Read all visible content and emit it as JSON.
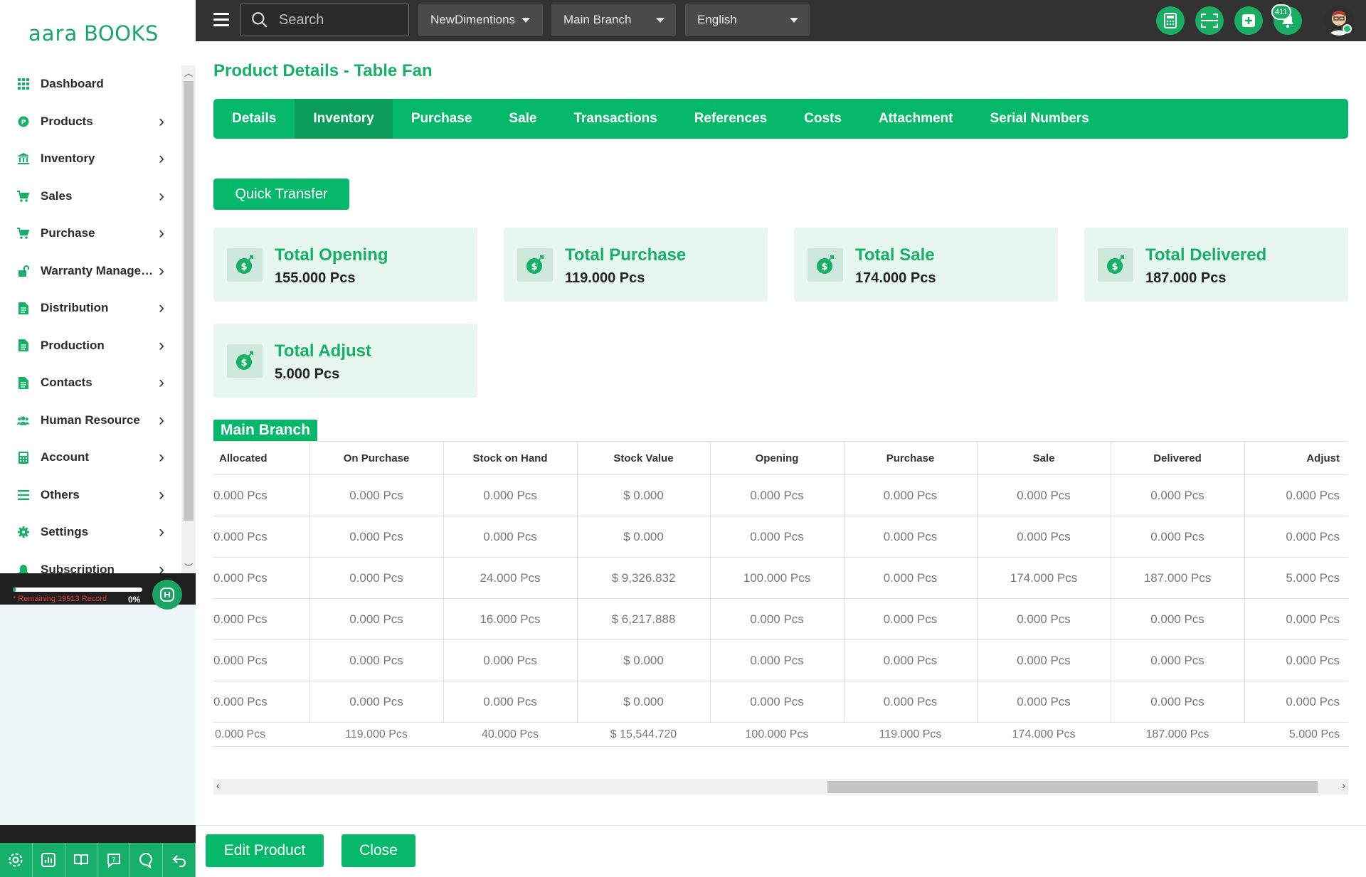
{
  "app": {
    "logo_text": "aaraBOOKS"
  },
  "sidebar": {
    "items": [
      {
        "label": "Dashboard",
        "icon": "dashboard-grid-icon",
        "has_children": false
      },
      {
        "label": "Products",
        "icon": "products-circle-icon",
        "has_children": true
      },
      {
        "label": "Inventory",
        "icon": "bank-building-icon",
        "has_children": true
      },
      {
        "label": "Sales",
        "icon": "cart-icon",
        "has_children": true
      },
      {
        "label": "Purchase",
        "icon": "cart-icon",
        "has_children": true
      },
      {
        "label": "Warranty Management",
        "icon": "unlock-icon",
        "has_children": true
      },
      {
        "label": "Distribution",
        "icon": "document-icon",
        "has_children": true
      },
      {
        "label": "Production",
        "icon": "document-icon",
        "has_children": true
      },
      {
        "label": "Contacts",
        "icon": "document-icon",
        "has_children": true
      },
      {
        "label": "Human Resource",
        "icon": "users-icon",
        "has_children": true
      },
      {
        "label": "Account",
        "icon": "calculator-icon",
        "has_children": true
      },
      {
        "label": "Others",
        "icon": "list-icon",
        "has_children": true
      },
      {
        "label": "Settings",
        "icon": "gear-icon",
        "has_children": true
      },
      {
        "label": "Subscription",
        "icon": "bell-icon",
        "has_children": true
      }
    ],
    "record_text": "* Remaining 19913 Record",
    "record_percent": "0%",
    "record_progress": 0.02,
    "bottom_icons": [
      "gear-icon",
      "chart-icon",
      "book-icon",
      "help-icon",
      "chat-icon",
      "undo-icon"
    ]
  },
  "topbar": {
    "search_placeholder": "Search",
    "company": "NewDimentions",
    "branch": "Main Branch",
    "language": "English",
    "notification_count": "411",
    "icons": [
      "calculator-icon",
      "scan-icon",
      "add-icon",
      "bell-icon"
    ]
  },
  "page": {
    "title": "Product Details - Table Fan",
    "tabs": [
      "Details",
      "Inventory",
      "Purchase",
      "Sale",
      "Transactions",
      "References",
      "Costs",
      "Attachment",
      "Serial Numbers"
    ],
    "active_tab": "Inventory",
    "quick_transfer_label": "Quick Transfer",
    "cards": [
      {
        "title": "Total Opening",
        "value": "155.000 Pcs"
      },
      {
        "title": "Total Purchase",
        "value": "119.000 Pcs"
      },
      {
        "title": "Total Sale",
        "value": "174.000 Pcs"
      },
      {
        "title": "Total Delivered",
        "value": "187.000 Pcs"
      },
      {
        "title": "Total Adjust",
        "value": "5.000 Pcs"
      }
    ],
    "branch_label": "Main Branch",
    "table": {
      "columns": [
        "Allocated",
        "On Purchase",
        "Stock on Hand",
        "Stock Value",
        "Opening",
        "Purchase",
        "Sale",
        "Delivered",
        "Adjust"
      ],
      "rows": [
        [
          "0.000 Pcs",
          "0.000 Pcs",
          "0.000 Pcs",
          "$ 0.000",
          "0.000 Pcs",
          "0.000 Pcs",
          "0.000 Pcs",
          "0.000 Pcs",
          "0.000 Pcs"
        ],
        [
          "0.000 Pcs",
          "0.000 Pcs",
          "0.000 Pcs",
          "$ 0.000",
          "0.000 Pcs",
          "0.000 Pcs",
          "0.000 Pcs",
          "0.000 Pcs",
          "0.000 Pcs"
        ],
        [
          "0.000 Pcs",
          "0.000 Pcs",
          "24.000 Pcs",
          "$ 9,326.832",
          "100.000 Pcs",
          "0.000 Pcs",
          "174.000 Pcs",
          "187.000 Pcs",
          "5.000 Pcs"
        ],
        [
          "0.000 Pcs",
          "0.000 Pcs",
          "16.000 Pcs",
          "$ 6,217.888",
          "0.000 Pcs",
          "0.000 Pcs",
          "0.000 Pcs",
          "0.000 Pcs",
          "0.000 Pcs"
        ],
        [
          "0.000 Pcs",
          "0.000 Pcs",
          "0.000 Pcs",
          "$ 0.000",
          "0.000 Pcs",
          "0.000 Pcs",
          "0.000 Pcs",
          "0.000 Pcs",
          "0.000 Pcs"
        ],
        [
          "0.000 Pcs",
          "0.000 Pcs",
          "0.000 Pcs",
          "$ 0.000",
          "0.000 Pcs",
          "0.000 Pcs",
          "0.000 Pcs",
          "0.000 Pcs",
          "0.000 Pcs"
        ]
      ],
      "totals": [
        "0.000 Pcs",
        "119.000 Pcs",
        "40.000 Pcs",
        "$ 15,544.720",
        "100.000 Pcs",
        "119.000 Pcs",
        "174.000 Pcs",
        "187.000 Pcs",
        "5.000 Pcs"
      ]
    },
    "edit_label": "Edit Product",
    "close_label": "Close"
  },
  "colors": {
    "accent": "#06b96a",
    "accent_dark": "#0a9d5a",
    "topbar": "#323232",
    "card_bg": "#e7f6ef"
  }
}
